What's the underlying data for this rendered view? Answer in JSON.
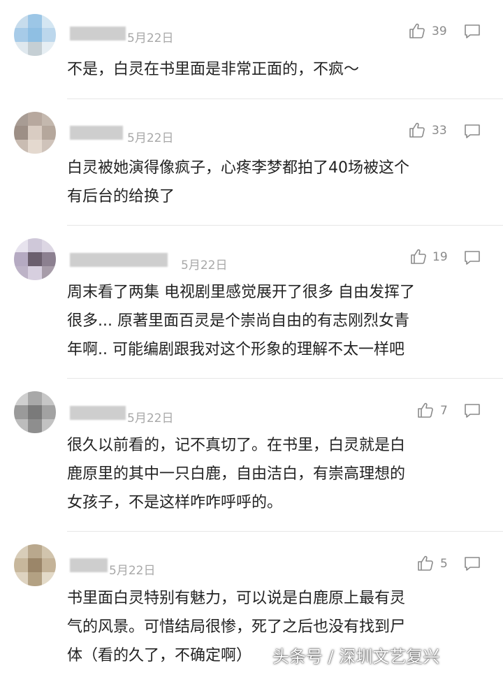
{
  "comments": [
    {
      "date": "5月22日",
      "likes": "39",
      "text": "不是，白灵在书里面是非常正面的，不疯～"
    },
    {
      "date": "5月22日",
      "likes": "33",
      "text": "白灵被她演得像疯子，心疼李梦都拍了40场被这个\n有后台的给换了"
    },
    {
      "date": "5月22日",
      "likes": "19",
      "text": "周末看了两集 电视剧里感觉展开了很多 自由发挥了\n很多... 原著里面百灵是个崇尚自由的有志刚烈女青\n年啊.. 可能编剧跟我对这个形象的理解不太一样吧"
    },
    {
      "date": "5月22日",
      "likes": "7",
      "text": "很久以前看的，记不真切了。在书里，白灵就是白\n鹿原里的其中一只白鹿，自由洁白，有崇高理想的\n女孩子，不是这样咋咋呼呼的。"
    },
    {
      "date": "5月22日",
      "likes": "5",
      "text": "书里面白灵特别有魅力，可以说是白鹿原上最有灵\n气的风景。可惜结局很惨，死了之后也没有找到尸\n体（看的久了，不确定啊）"
    }
  ],
  "watermark": "头条号 / 深圳文艺复兴",
  "icons": {
    "like": "thumbs-up-icon",
    "reply": "comment-bubble-icon"
  },
  "colors": {
    "text": "#222222",
    "meta": "#a8a8a8",
    "divider": "#e6e6e6"
  }
}
